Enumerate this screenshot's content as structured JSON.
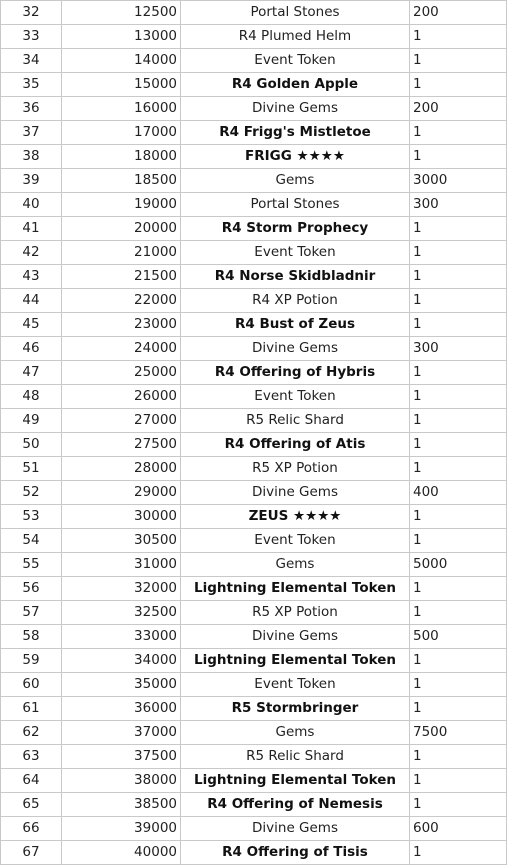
{
  "rows": [
    {
      "rank": "32",
      "points": "12500",
      "reward": "Portal Stones",
      "qty": "200",
      "bold": false
    },
    {
      "rank": "33",
      "points": "13000",
      "reward": "R4 Plumed Helm",
      "qty": "1",
      "bold": false
    },
    {
      "rank": "34",
      "points": "14000",
      "reward": "Event Token",
      "qty": "1",
      "bold": false
    },
    {
      "rank": "35",
      "points": "15000",
      "reward": "R4 Golden Apple",
      "qty": "1",
      "bold": true
    },
    {
      "rank": "36",
      "points": "16000",
      "reward": "Divine Gems",
      "qty": "200",
      "bold": false
    },
    {
      "rank": "37",
      "points": "17000",
      "reward": "R4 Frigg's Mistletoe",
      "qty": "1",
      "bold": true
    },
    {
      "rank": "38",
      "points": "18000",
      "reward": "FRIGG ★★★★",
      "qty": "1",
      "bold": true
    },
    {
      "rank": "39",
      "points": "18500",
      "reward": "Gems",
      "qty": "3000",
      "bold": false
    },
    {
      "rank": "40",
      "points": "19000",
      "reward": "Portal Stones",
      "qty": "300",
      "bold": false
    },
    {
      "rank": "41",
      "points": "20000",
      "reward": "R4 Storm Prophecy",
      "qty": "1",
      "bold": true
    },
    {
      "rank": "42",
      "points": "21000",
      "reward": "Event Token",
      "qty": "1",
      "bold": false
    },
    {
      "rank": "43",
      "points": "21500",
      "reward": "R4 Norse Skidbladnir",
      "qty": "1",
      "bold": true
    },
    {
      "rank": "44",
      "points": "22000",
      "reward": "R4 XP Potion",
      "qty": "1",
      "bold": false
    },
    {
      "rank": "45",
      "points": "23000",
      "reward": "R4 Bust of Zeus",
      "qty": "1",
      "bold": true
    },
    {
      "rank": "46",
      "points": "24000",
      "reward": "Divine Gems",
      "qty": "300",
      "bold": false
    },
    {
      "rank": "47",
      "points": "25000",
      "reward": "R4 Offering of Hybris",
      "qty": "1",
      "bold": true
    },
    {
      "rank": "48",
      "points": "26000",
      "reward": "Event Token",
      "qty": "1",
      "bold": false
    },
    {
      "rank": "49",
      "points": "27000",
      "reward": "R5 Relic Shard",
      "qty": "1",
      "bold": false
    },
    {
      "rank": "50",
      "points": "27500",
      "reward": "R4 Offering of Atis",
      "qty": "1",
      "bold": true
    },
    {
      "rank": "51",
      "points": "28000",
      "reward": "R5 XP Potion",
      "qty": "1",
      "bold": false
    },
    {
      "rank": "52",
      "points": "29000",
      "reward": "Divine Gems",
      "qty": "400",
      "bold": false
    },
    {
      "rank": "53",
      "points": "30000",
      "reward": "ZEUS ★★★★",
      "qty": "1",
      "bold": true
    },
    {
      "rank": "54",
      "points": "30500",
      "reward": "Event Token",
      "qty": "1",
      "bold": false
    },
    {
      "rank": "55",
      "points": "31000",
      "reward": "Gems",
      "qty": "5000",
      "bold": false
    },
    {
      "rank": "56",
      "points": "32000",
      "reward": "Lightning Elemental Token",
      "qty": "1",
      "bold": true
    },
    {
      "rank": "57",
      "points": "32500",
      "reward": "R5 XP Potion",
      "qty": "1",
      "bold": false
    },
    {
      "rank": "58",
      "points": "33000",
      "reward": "Divine Gems",
      "qty": "500",
      "bold": false
    },
    {
      "rank": "59",
      "points": "34000",
      "reward": "Lightning Elemental Token",
      "qty": "1",
      "bold": true
    },
    {
      "rank": "60",
      "points": "35000",
      "reward": "Event Token",
      "qty": "1",
      "bold": false
    },
    {
      "rank": "61",
      "points": "36000",
      "reward": "R5 Stormbringer",
      "qty": "1",
      "bold": true
    },
    {
      "rank": "62",
      "points": "37000",
      "reward": "Gems",
      "qty": "7500",
      "bold": false
    },
    {
      "rank": "63",
      "points": "37500",
      "reward": "R5 Relic Shard",
      "qty": "1",
      "bold": false
    },
    {
      "rank": "64",
      "points": "38000",
      "reward": "Lightning Elemental Token",
      "qty": "1",
      "bold": true
    },
    {
      "rank": "65",
      "points": "38500",
      "reward": "R4 Offering of Nemesis",
      "qty": "1",
      "bold": true
    },
    {
      "rank": "66",
      "points": "39000",
      "reward": "Divine Gems",
      "qty": "600",
      "bold": false
    },
    {
      "rank": "67",
      "points": "40000",
      "reward": "R4 Offering of Tisis",
      "qty": "1",
      "bold": true
    }
  ]
}
